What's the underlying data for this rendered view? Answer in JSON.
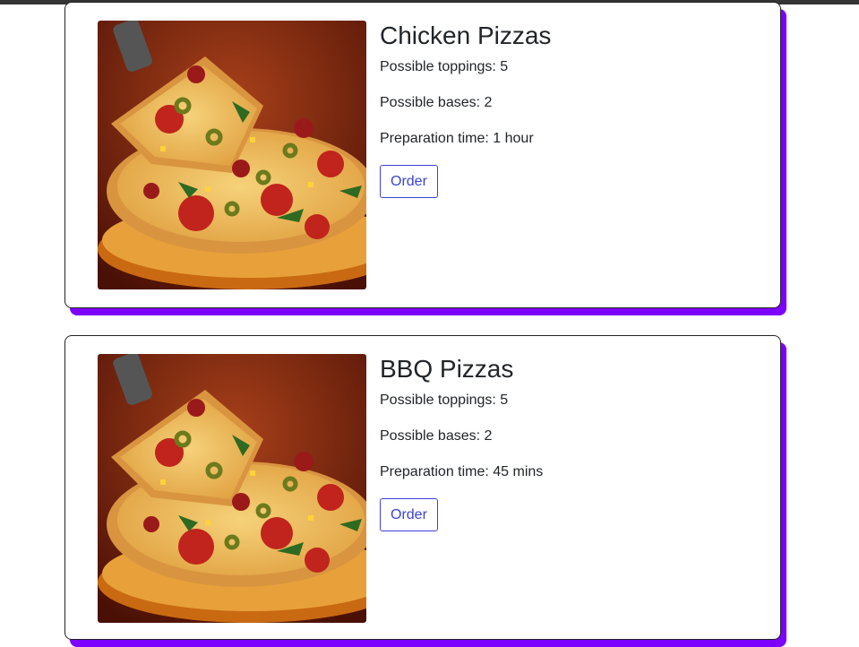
{
  "cards": [
    {
      "title": "Chicken Pizzas",
      "toppings": "Possible toppings: 5",
      "bases": "Possible bases: 2",
      "prep": "Preparation time: 1 hour",
      "order_label": "Order"
    },
    {
      "title": "BBQ Pizzas",
      "toppings": "Possible toppings: 5",
      "bases": "Possible bases: 2",
      "prep": "Preparation time: 45 mins",
      "order_label": "Order"
    }
  ],
  "colors": {
    "accent_shadow": "#7c00ff",
    "button": "#3b42d8",
    "topbar": "#343434"
  }
}
